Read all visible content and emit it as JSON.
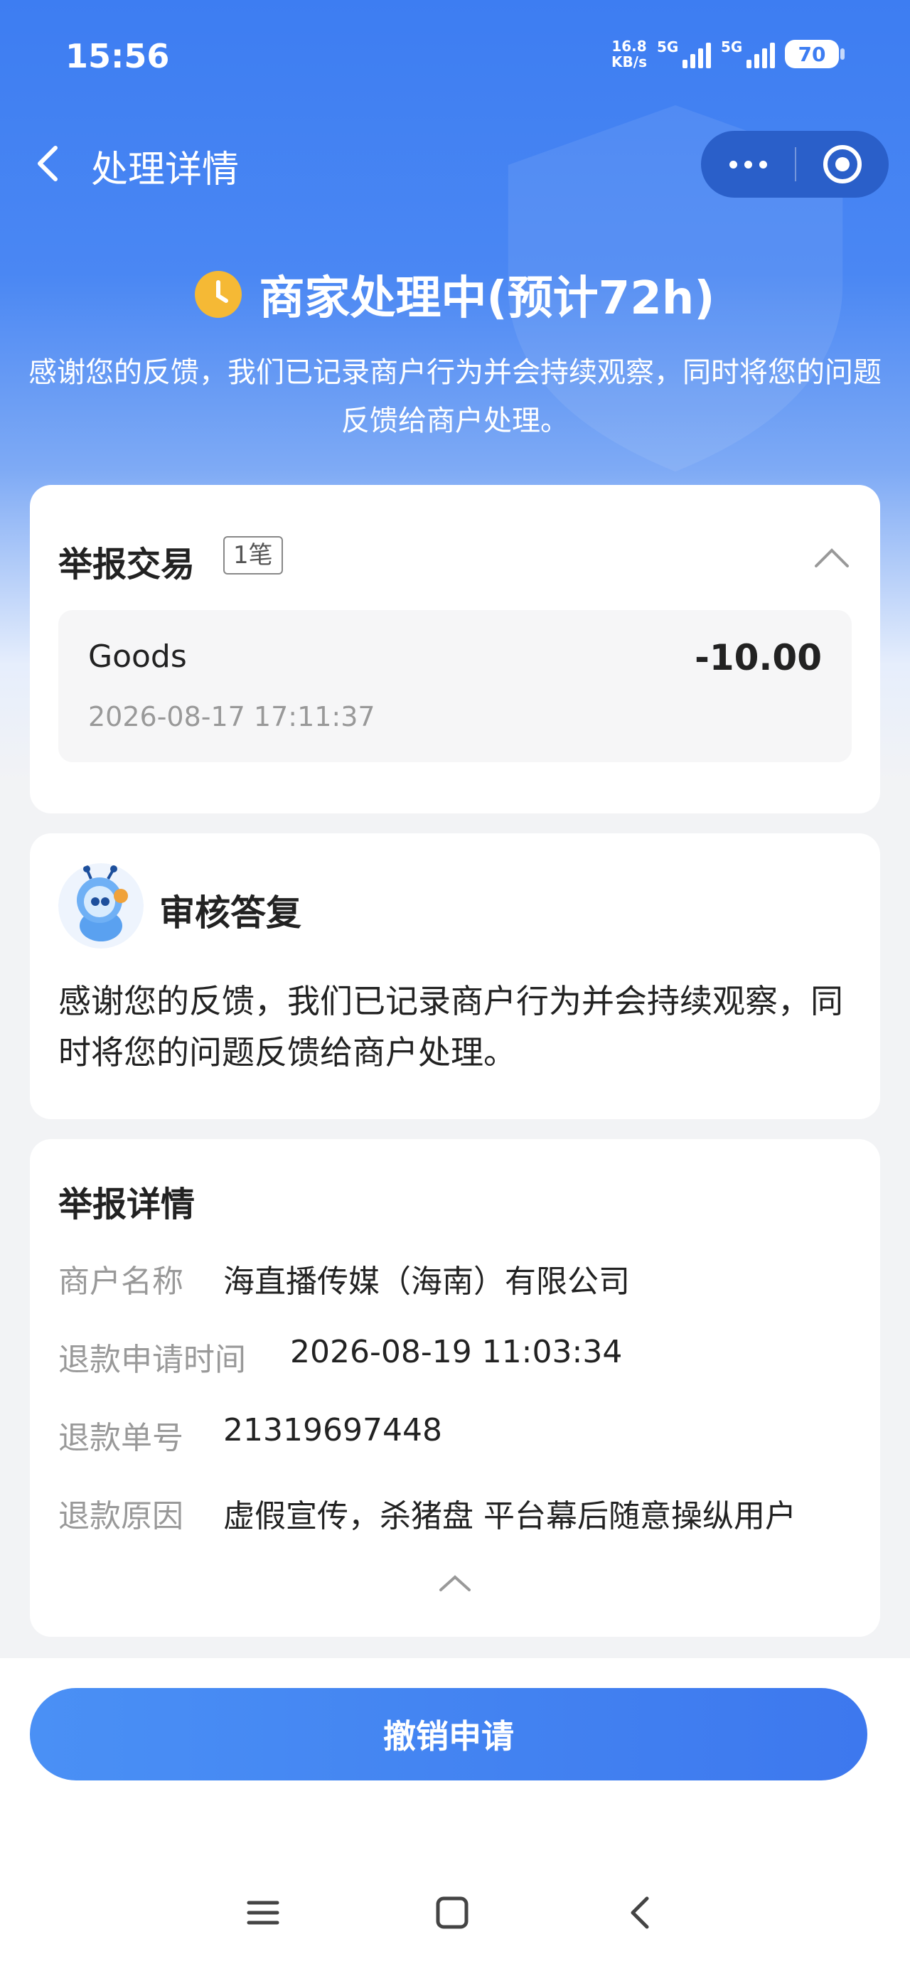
{
  "status_bar": {
    "time": "15:56",
    "net_speed_value": "16.8",
    "net_speed_unit": "KB/s",
    "network_1": "5G",
    "network_2": "5G",
    "battery": "70"
  },
  "nav": {
    "title": "处理详情"
  },
  "hero": {
    "status_title": "商家处理中(预计72h)",
    "description": "感谢您的反馈，我们已记录商户行为并会持续观察，同时将您的问题反馈给商户处理。"
  },
  "report_transaction": {
    "title": "举报交易",
    "count_tag": "1笔",
    "transaction": {
      "name": "Goods",
      "amount": "-10.00",
      "time": "2026-08-17 17:11:37"
    }
  },
  "review_reply": {
    "title": "审核答复",
    "text": "感谢您的反馈，我们已记录商户行为并会持续观察，同时将您的问题反馈给商户处理。"
  },
  "report_details": {
    "title": "举报详情",
    "rows": [
      {
        "key": "商户名称",
        "value": "海直播传媒（海南）有限公司"
      },
      {
        "key": "退款申请时间",
        "value": "2026-08-19 11:03:34"
      },
      {
        "key": "退款单号",
        "value": "21319697448"
      },
      {
        "key": "退款原因",
        "value": "虚假宣传，杀猪盘 平台幕后随意操纵用户"
      }
    ]
  },
  "bottom": {
    "cancel_label": "撤销申请"
  },
  "colors": {
    "brand_blue": "#3d7df2",
    "clock_yellow": "#f5b935"
  }
}
